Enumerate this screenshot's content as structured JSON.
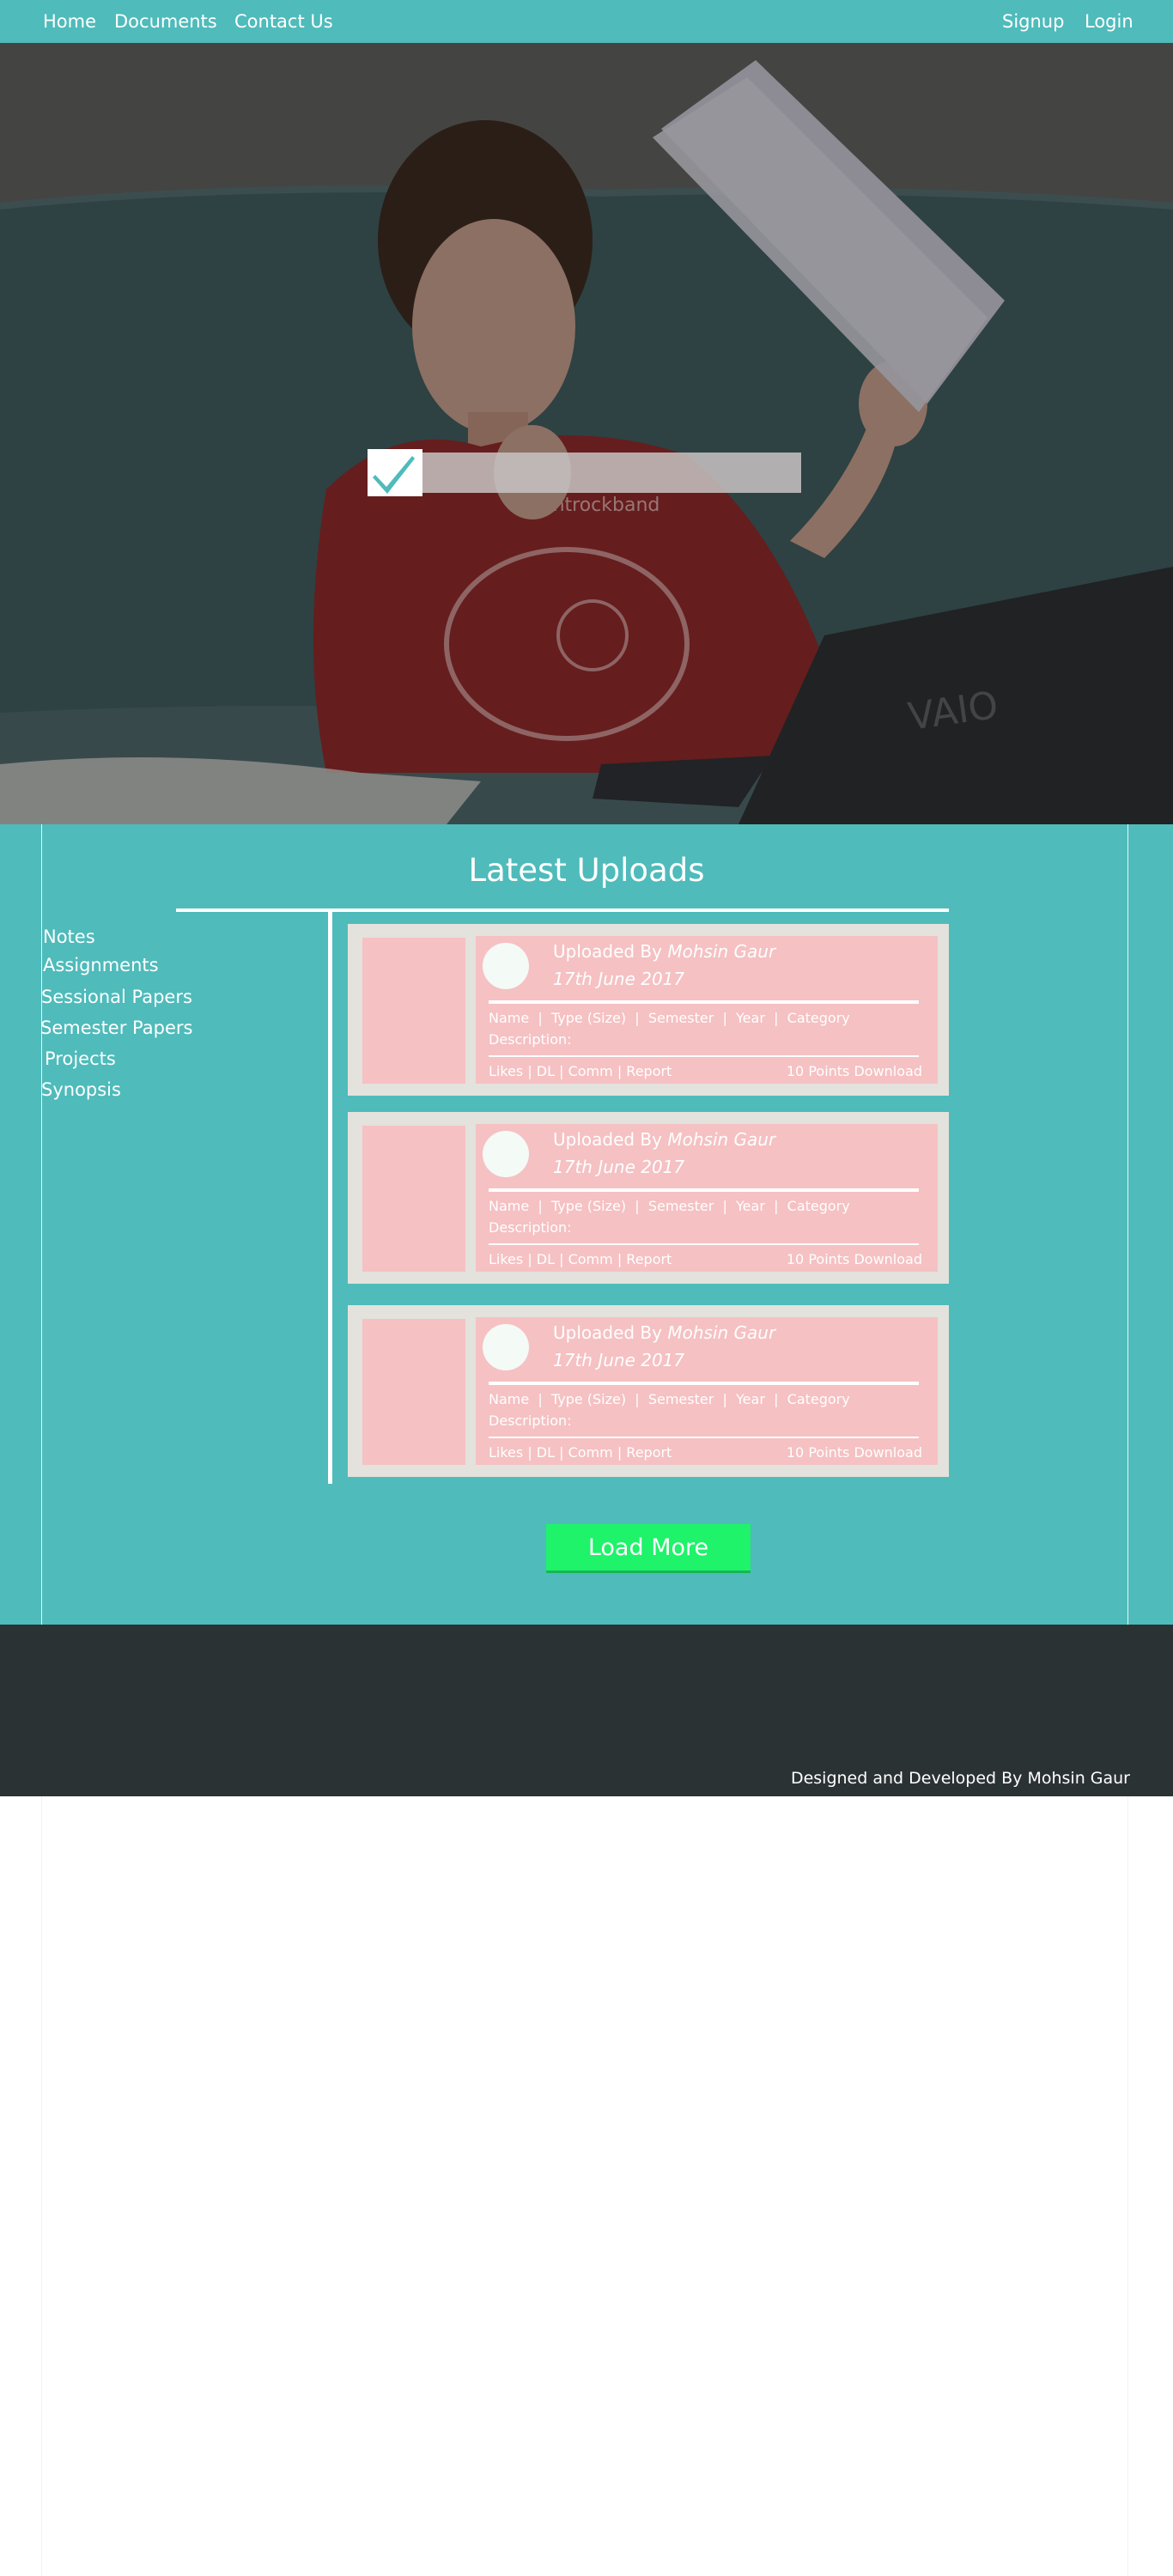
{
  "nav": {
    "left": [
      "Home",
      "Documents",
      "Contact Us"
    ],
    "right": [
      "Signup",
      "Login"
    ]
  },
  "hero": {
    "search_placeholder": "",
    "icon": "checkmark-icon",
    "laptop_brand": "VAIO",
    "shirt_text": "stantrockband"
  },
  "main": {
    "title": "Latest Uploads",
    "sidebar": [
      "Notes",
      "Assignments",
      "Sessional Papers",
      "Semester Papers",
      "Projects",
      "Synopsis"
    ],
    "cards": [
      {
        "uploaded_by_label": "Uploaded By",
        "uploader": "Mohsin Gaur",
        "date": "17th June 2017",
        "meta": "Name  |  Type (Size)  |  Semester  |  Year  |  Category",
        "description": "Description:",
        "actions": "Likes | DL | Comm | Report",
        "points": "10 Points Download"
      },
      {
        "uploaded_by_label": "Uploaded By",
        "uploader": "Mohsin Gaur",
        "date": "17th June 2017",
        "meta": "Name  |  Type (Size)  |  Semester  |  Year  |  Category",
        "description": "Description:",
        "actions": "Likes | DL | Comm | Report",
        "points": "10 Points Download"
      },
      {
        "uploaded_by_label": "Uploaded By",
        "uploader": "Mohsin Gaur",
        "date": "17th June 2017",
        "meta": "Name  |  Type (Size)  |  Semester  |  Year  |  Category",
        "description": "Description:",
        "actions": "Likes | DL | Comm | Report",
        "points": "10 Points Download"
      }
    ],
    "load_more": "Load More"
  },
  "footer": {
    "credit": "Designed and Developed By Mohsin Gaur"
  },
  "colors": {
    "teal": "#4fbbbb",
    "card_bg": "#e4e2dd",
    "card_pink": "#f5c1c3",
    "button_green": "#1ef36a",
    "footer": "#2b3234"
  }
}
